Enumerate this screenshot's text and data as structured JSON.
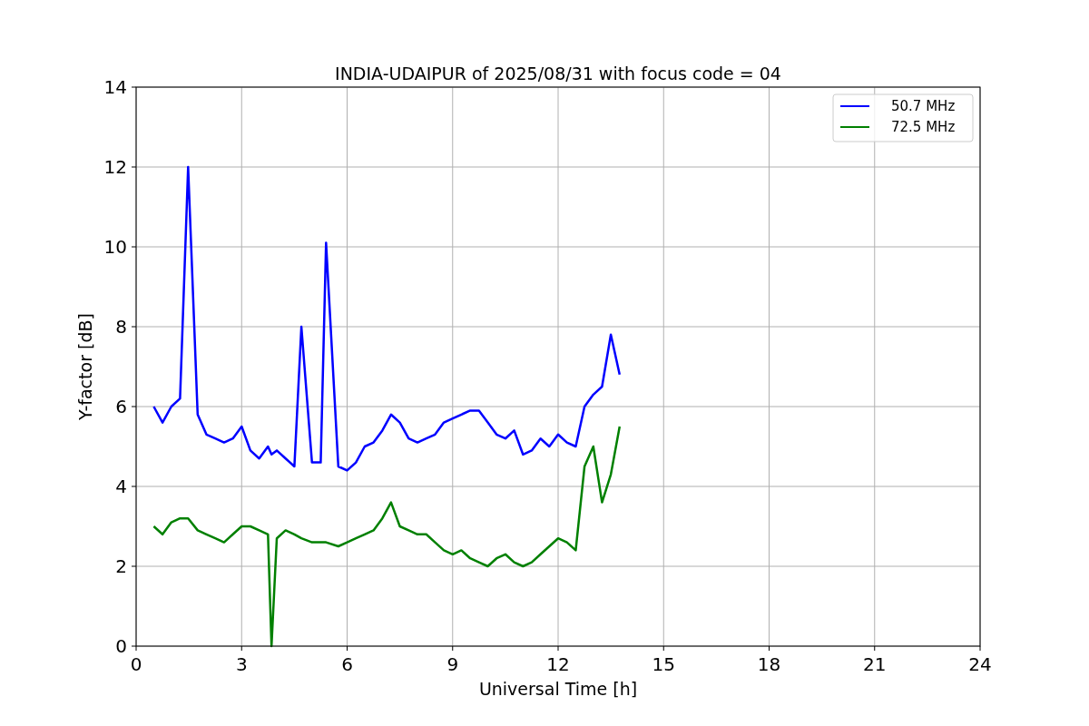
{
  "chart": {
    "chart_data": {
      "type": "line",
      "title": "INDIA-UDAIPUR of 2025/08/31 with focus code = 04",
      "xlabel": "Universal Time [h]",
      "ylabel": "Y-factor [dB]",
      "x": [
        0.5,
        0.75,
        1.0,
        1.25,
        1.48,
        1.75,
        2.0,
        2.25,
        2.5,
        2.75,
        3.0,
        3.25,
        3.5,
        3.75,
        3.85,
        4.0,
        4.25,
        4.5,
        4.7,
        5.0,
        5.25,
        5.4,
        5.75,
        6.0,
        6.25,
        6.5,
        6.75,
        7.0,
        7.25,
        7.5,
        7.75,
        8.0,
        8.25,
        8.5,
        8.75,
        9.0,
        9.25,
        9.5,
        9.75,
        10.0,
        10.25,
        10.5,
        10.75,
        11.0,
        11.25,
        11.5,
        11.75,
        12.0,
        12.25,
        12.5,
        12.75,
        13.0,
        13.25,
        13.5,
        13.75
      ],
      "series": [
        {
          "name": "50.7 MHz",
          "color": "#0000ff",
          "values": [
            6.0,
            5.6,
            6.0,
            6.2,
            12.0,
            5.8,
            5.3,
            5.2,
            5.1,
            5.2,
            5.5,
            4.9,
            4.7,
            5.0,
            4.8,
            4.9,
            4.7,
            4.5,
            8.0,
            4.6,
            4.6,
            10.1,
            4.5,
            4.4,
            4.6,
            5.0,
            5.1,
            5.4,
            5.8,
            5.6,
            5.2,
            5.1,
            5.2,
            5.3,
            5.6,
            5.7,
            5.8,
            5.9,
            5.9,
            5.6,
            5.3,
            5.2,
            5.4,
            4.8,
            4.9,
            5.2,
            5.0,
            5.3,
            5.1,
            5.0,
            6.0,
            6.3,
            6.5,
            7.8,
            6.8
          ]
        },
        {
          "name": "72.5 MHz",
          "color": "#008000",
          "values": [
            3.0,
            2.8,
            3.1,
            3.2,
            3.2,
            2.9,
            2.8,
            2.7,
            2.6,
            2.8,
            3.0,
            3.0,
            2.9,
            2.8,
            0.0,
            2.7,
            2.9,
            2.8,
            2.7,
            2.6,
            2.6,
            2.6,
            2.5,
            2.6,
            2.7,
            2.8,
            2.9,
            3.2,
            3.6,
            3.0,
            2.9,
            2.8,
            2.8,
            2.6,
            2.4,
            2.3,
            2.4,
            2.2,
            2.1,
            2.0,
            2.2,
            2.3,
            2.1,
            2.0,
            2.1,
            2.3,
            2.5,
            2.7,
            2.6,
            2.4,
            4.5,
            5.0,
            3.6,
            4.3,
            5.5
          ]
        }
      ],
      "grid": true,
      "legend": true,
      "xlim": [
        0,
        24
      ],
      "ylim": [
        0,
        14
      ],
      "xticks": [
        0,
        3,
        6,
        9,
        12,
        15,
        18,
        21,
        24
      ],
      "yticks": [
        0,
        2,
        4,
        6,
        8,
        10,
        12,
        14
      ]
    }
  }
}
